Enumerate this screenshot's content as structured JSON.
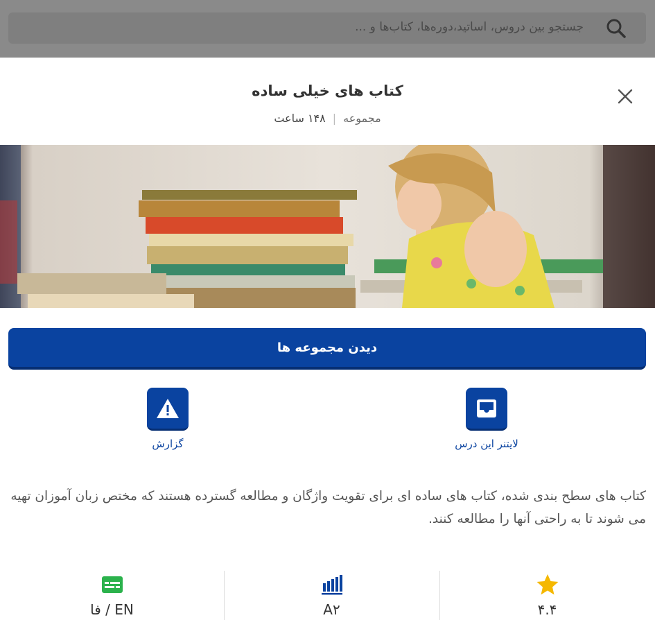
{
  "search": {
    "placeholder": "جستجو بین دروس، اساتید،دوره‌ها، کتاب‌ها و ..."
  },
  "sheet": {
    "title": "کتاب های خیلی ساده",
    "type_label": "مجموعه",
    "duration": "۱۴۸ ساعت",
    "primary_button": "دیدن مجموعه ها",
    "actions": {
      "lightner": "لایتنر این درس",
      "report": "گزارش"
    },
    "description": "کتاب های سطح بندی شده، کتاب های ساده ای برای تقویت واژگان و مطالعه گسترده هستند که مختص زبان آموزان تهیه می شوند تا به راحتی آنها را مطالعه کنند.",
    "stats": {
      "rating": "۴.۴",
      "level": "A۲",
      "language": "فا / EN"
    }
  },
  "colors": {
    "primary": "#0a43a0",
    "star": "#f5b800",
    "language_icon": "#2bb24c"
  },
  "icons": [
    "search-icon",
    "close-icon",
    "inbox-icon",
    "warning-icon",
    "star-icon",
    "level-bars-icon",
    "subtitles-icon"
  ]
}
